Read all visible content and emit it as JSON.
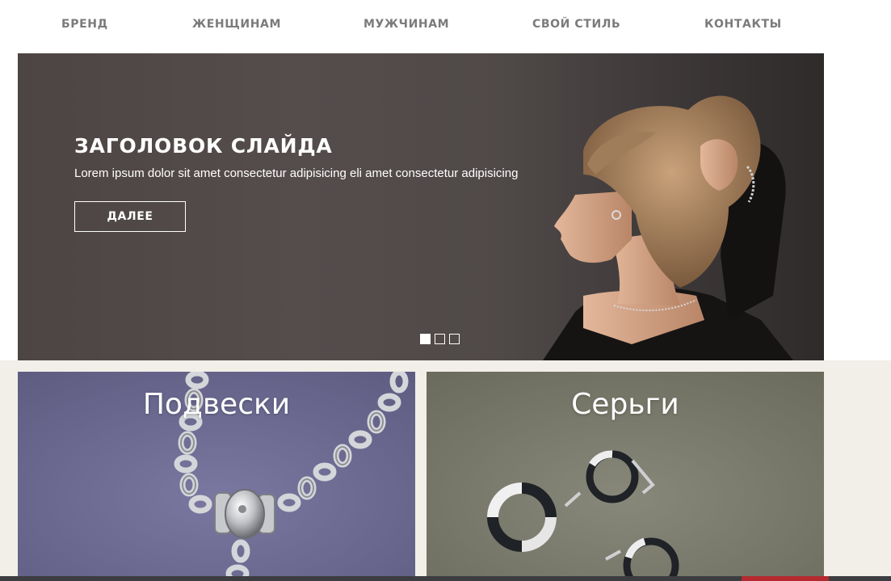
{
  "nav": {
    "items": [
      {
        "label": "БРЕНД"
      },
      {
        "label": "ЖЕНЩИНАМ"
      },
      {
        "label": "МУЖЧИНАМ"
      },
      {
        "label": "СВОЙ СТИЛЬ"
      },
      {
        "label": "КОНТАКТЫ"
      }
    ]
  },
  "hero": {
    "title": "ЗАГОЛОВОК СЛАЙДА",
    "subtitle": "Lorem ipsum dolor sit amet consectetur adipisicing eli amet consectetur adipisicing",
    "button_label": "ДАЛЕЕ",
    "slides_total": 3,
    "active_slide": 1
  },
  "categories": [
    {
      "title": "Подвески"
    },
    {
      "title": "Серьги"
    }
  ],
  "colors": {
    "nav_text": "#7b7b7b",
    "category_band": "#f2efe9",
    "bottom_bar": "#3c3d40",
    "bottom_accent": "#b52a2f"
  }
}
